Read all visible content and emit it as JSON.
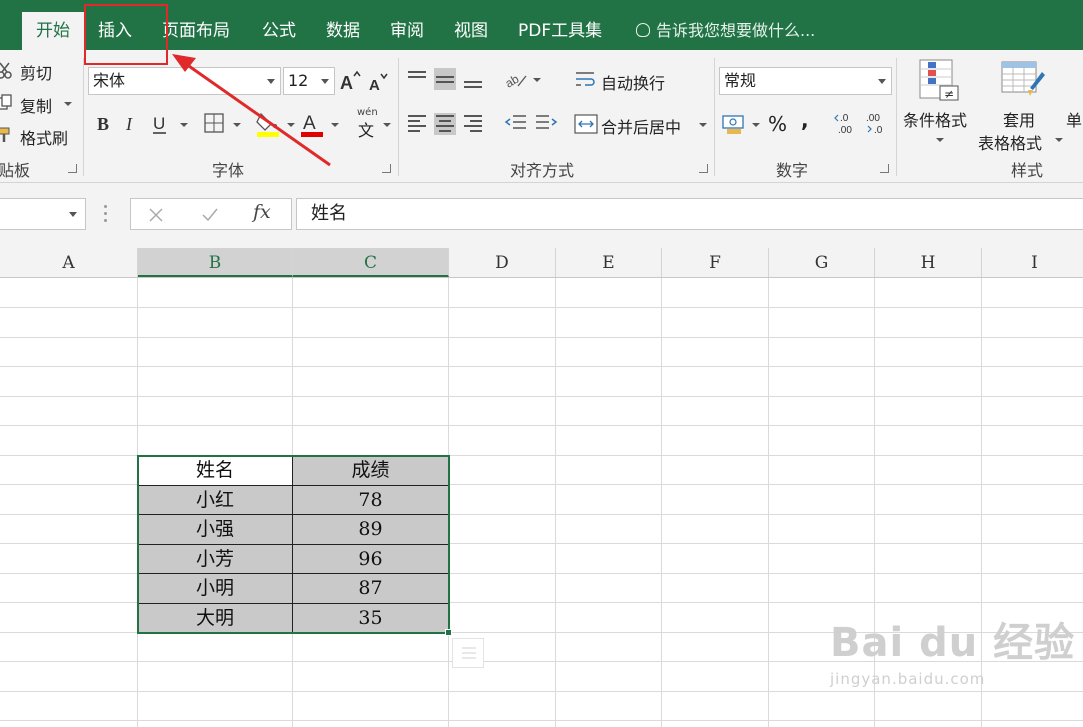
{
  "tabs": [
    "开始",
    "插入",
    "页面布局",
    "公式",
    "数据",
    "审阅",
    "视图",
    "PDF工具集"
  ],
  "tell_me": "告诉我您想要做什么...",
  "ribbon": {
    "clipboard": {
      "cut": "剪切",
      "copy": "复制",
      "format_painter": "格式刷",
      "group": "贴板"
    },
    "font": {
      "name": "宋体",
      "size": "12",
      "group": "字体",
      "phonetic_top": "wén",
      "phonetic_char": "文"
    },
    "alignment": {
      "wrap": "自动换行",
      "merge": "合并后居中",
      "group": "对齐方式"
    },
    "number": {
      "format": "常规",
      "group": "数字"
    },
    "styles": {
      "conditional": "条件格式",
      "table_line1": "套用",
      "table_line2": "表格格式",
      "cell": "单",
      "group": "样式"
    }
  },
  "formula_bar": {
    "fx": "fx",
    "content": "姓名"
  },
  "columns": [
    "A",
    "B",
    "C",
    "D",
    "E",
    "F",
    "G",
    "H",
    "I"
  ],
  "table": {
    "headers": [
      "姓名",
      "成绩"
    ],
    "rows": [
      [
        "小红",
        "78"
      ],
      [
        "小强",
        "89"
      ],
      [
        "小芳",
        "96"
      ],
      [
        "小明",
        "87"
      ],
      [
        "大明",
        "35"
      ]
    ]
  },
  "watermark": {
    "brand": "Bai du 经验",
    "url": "jingyan.baidu.com"
  },
  "colors": {
    "excel_green": "#217346",
    "highlight_red": "#e02a2a",
    "cell_fill": "#c9c9c9"
  }
}
